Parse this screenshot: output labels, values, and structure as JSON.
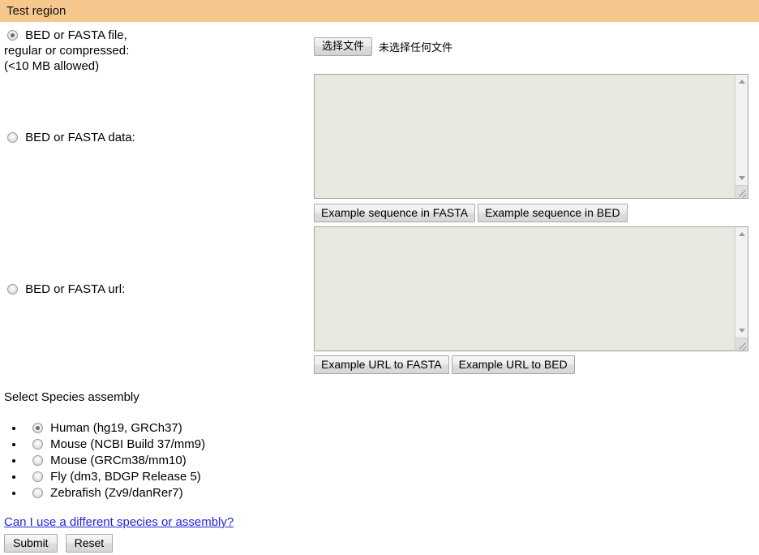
{
  "header": {
    "title": "Test region",
    "bg_color": "#f6c78d"
  },
  "input_options": [
    {
      "id": "file",
      "label_lines": [
        "BED or FASTA file,",
        "regular or compressed:",
        "(<10 MB allowed)"
      ],
      "checked": true
    },
    {
      "id": "data",
      "label_lines": [
        "BED or FASTA data:"
      ],
      "checked": false
    },
    {
      "id": "url",
      "label_lines": [
        "BED or FASTA url:"
      ],
      "checked": false
    }
  ],
  "file_input": {
    "button_label": "选择文件",
    "status_text": "未选择任何文件"
  },
  "data_textarea": {
    "value": "",
    "placeholder": ""
  },
  "url_textarea": {
    "value": "",
    "placeholder": ""
  },
  "data_examples": [
    {
      "label": "Example sequence in FASTA"
    },
    {
      "label": "Example sequence in BED"
    }
  ],
  "url_examples": [
    {
      "label": "Example URL to FASTA"
    },
    {
      "label": "Example URL to BED"
    }
  ],
  "species": {
    "heading": "Select Species assembly",
    "items": [
      {
        "label": "Human (hg19, GRCh37)",
        "checked": true
      },
      {
        "label": "Mouse (NCBI Build 37/mm9)",
        "checked": false
      },
      {
        "label": "Mouse (GRCm38/mm10)",
        "checked": false
      },
      {
        "label": "Fly (dm3, BDGP Release 5)",
        "checked": false
      },
      {
        "label": "Zebrafish (Zv9/danRer7)",
        "checked": false
      }
    ]
  },
  "help_link": {
    "text": "Can I use a different species or assembly?",
    "color": "#2323dc"
  },
  "actions": [
    {
      "label": "Submit"
    },
    {
      "label": "Reset"
    }
  ]
}
